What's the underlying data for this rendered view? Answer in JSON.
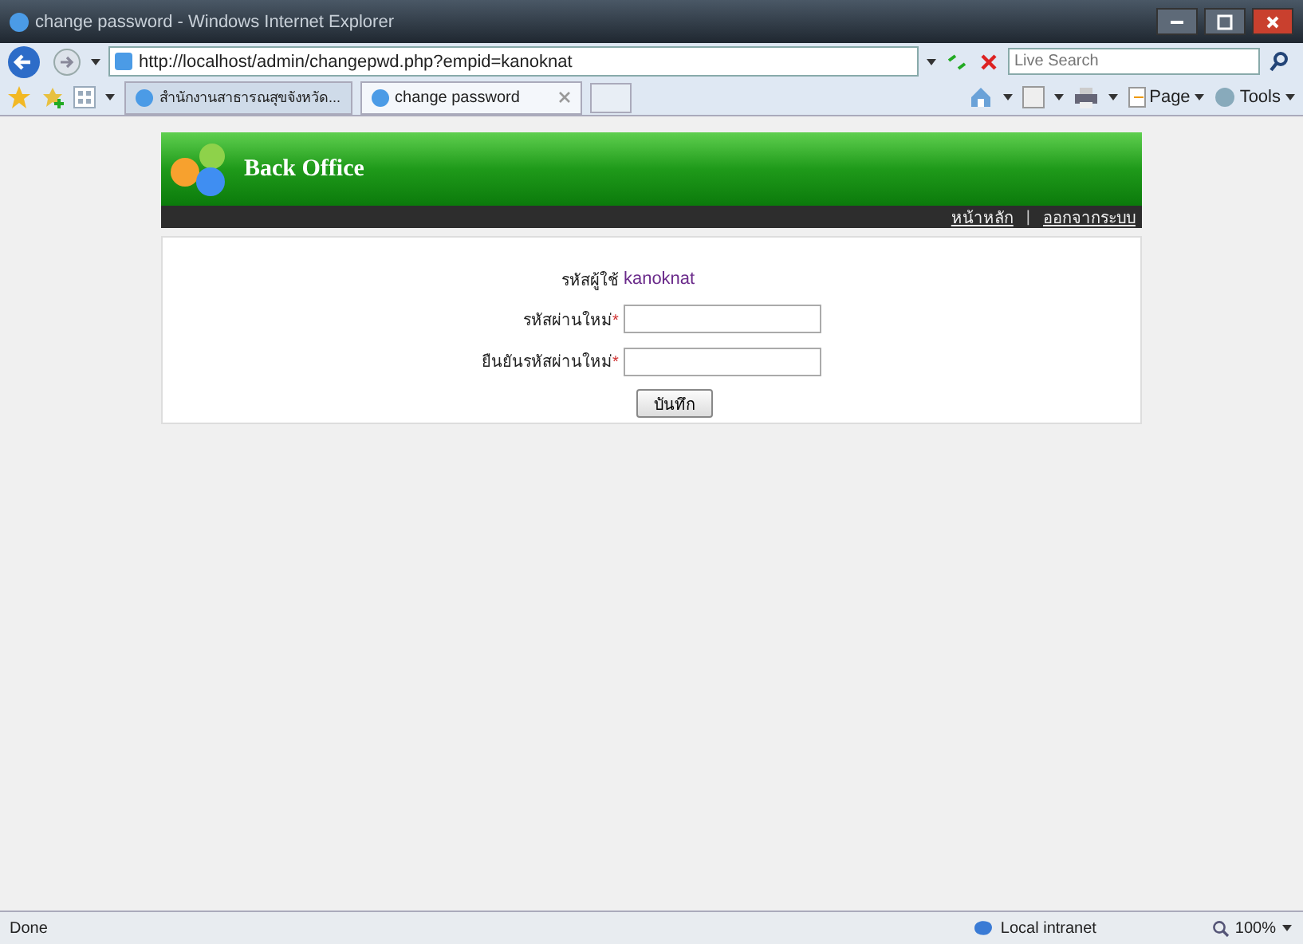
{
  "window": {
    "title": "change password - Windows Internet Explorer"
  },
  "address_bar": {
    "url": "http://localhost/admin/changepwd.php?empid=kanoknat"
  },
  "search": {
    "placeholder": "Live Search"
  },
  "tabs": [
    {
      "label": "สำนักงานสาธารณสุขจังหวัด...",
      "selected": false
    },
    {
      "label": "change password",
      "selected": true
    }
  ],
  "command_bar": {
    "page": "Page",
    "tools": "Tools"
  },
  "header": {
    "title": "Back Office",
    "links": [
      "หน้าหลัก",
      "ออกจากระบบ"
    ],
    "separator": "|"
  },
  "form": {
    "user_label": "รหัสผู้ใช้",
    "user_value": "kanoknat",
    "fields": [
      {
        "label": "รหัสผ่านใหม่",
        "required": "*"
      },
      {
        "label": "ยืนยันรหัสผ่านใหม่",
        "required": "*"
      }
    ],
    "submit": "บันทึก"
  },
  "status_bar": {
    "text": "Done",
    "zone": "Local intranet",
    "zoom": "100%"
  }
}
